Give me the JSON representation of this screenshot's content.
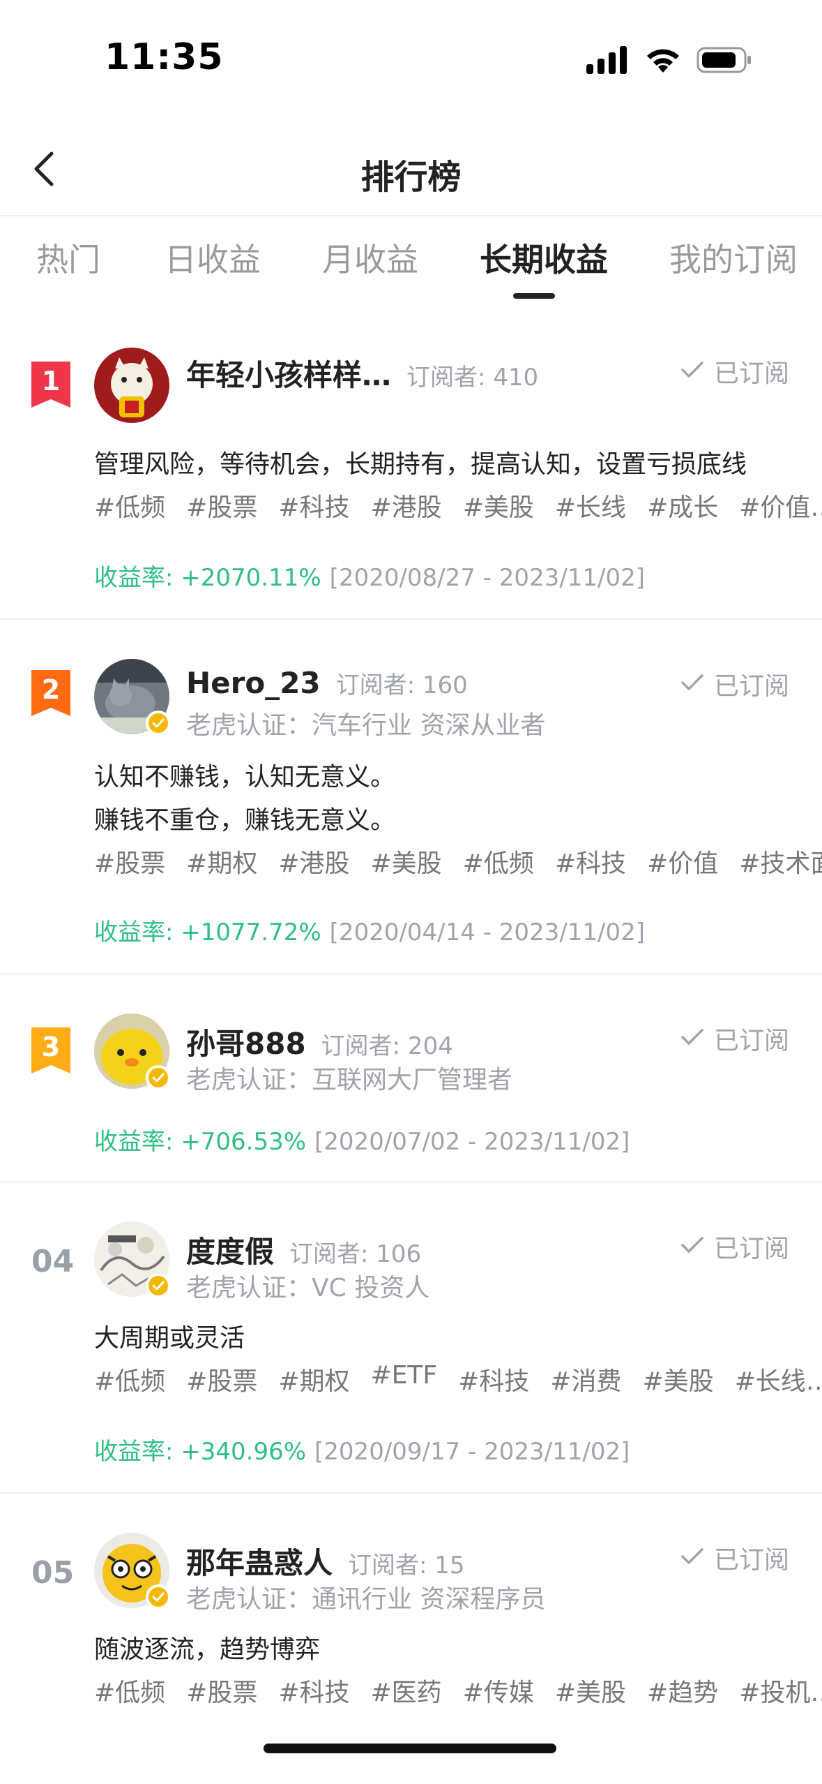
{
  "status": {
    "time": "11:35"
  },
  "nav": {
    "title": "排行榜"
  },
  "tabs": [
    {
      "label": "热门"
    },
    {
      "label": "日收益"
    },
    {
      "label": "月收益"
    },
    {
      "label": "长期收益",
      "active": true
    },
    {
      "label": "我的订阅"
    }
  ],
  "accent_green": "#2fbf84",
  "items": [
    {
      "rank": "1",
      "rank_color": "#f0364a",
      "name": "年轻小孩样样…",
      "subscribers": "订阅者: 410",
      "subscribed_label": "已订阅",
      "cert": "",
      "desc": [
        "管理风险，等待机会，长期持有，提高认知，设置亏损底线"
      ],
      "tags": [
        "#低频",
        "#股票",
        "#科技",
        "#港股",
        "#美股",
        "#长线",
        "#成长",
        "#价值…"
      ],
      "yield_label": "收益率: ",
      "yield_value": "+2070.11%",
      "range": "[2020/08/27 - 2023/11/02]"
    },
    {
      "rank": "2",
      "rank_color": "#ff6a13",
      "name": "Hero_23",
      "subscribers": "订阅者: 160",
      "subscribed_label": "已订阅",
      "cert": "老虎认证：汽车行业 资深从业者",
      "desc": [
        "认知不赚钱，认知无意义。",
        "赚钱不重仓，赚钱无意义。"
      ],
      "tags": [
        "#股票",
        "#期权",
        "#港股",
        "#美股",
        "#低频",
        "#科技",
        "#价值",
        "#技术面"
      ],
      "yield_label": "收益率: ",
      "yield_value": "+1077.72%",
      "range": "[2020/04/14 - 2023/11/02]"
    },
    {
      "rank": "3",
      "rank_color": "#ffac16",
      "name": "孙哥888",
      "subscribers": "订阅者: 204",
      "subscribed_label": "已订阅",
      "cert": "老虎认证：互联网大厂管理者",
      "desc": [],
      "tags": [],
      "yield_label": "收益率: ",
      "yield_value": "+706.53%",
      "range": "[2020/07/02 - 2023/11/02]"
    },
    {
      "rank": "04",
      "name": "度度假",
      "subscribers": "订阅者: 106",
      "subscribed_label": "已订阅",
      "cert": "老虎认证：VC 投资人",
      "desc": [
        "大周期或灵活"
      ],
      "tags": [
        "#低频",
        "#股票",
        "#期权",
        "#ETF",
        "#科技",
        "#消费",
        "#美股",
        "#长线…"
      ],
      "yield_label": "收益率: ",
      "yield_value": "+340.96%",
      "range": "[2020/09/17 - 2023/11/02]"
    },
    {
      "rank": "05",
      "name": "那年蛊惑人",
      "subscribers": "订阅者: 15",
      "subscribed_label": "已订阅",
      "cert": "老虎认证：通讯行业 资深程序员",
      "desc": [
        "随波逐流，趋势博弈"
      ],
      "tags": [
        "#低频",
        "#股票",
        "#科技",
        "#医药",
        "#传媒",
        "#美股",
        "#趋势",
        "#投机…"
      ],
      "yield_label": "",
      "yield_value": "",
      "range": ""
    }
  ]
}
